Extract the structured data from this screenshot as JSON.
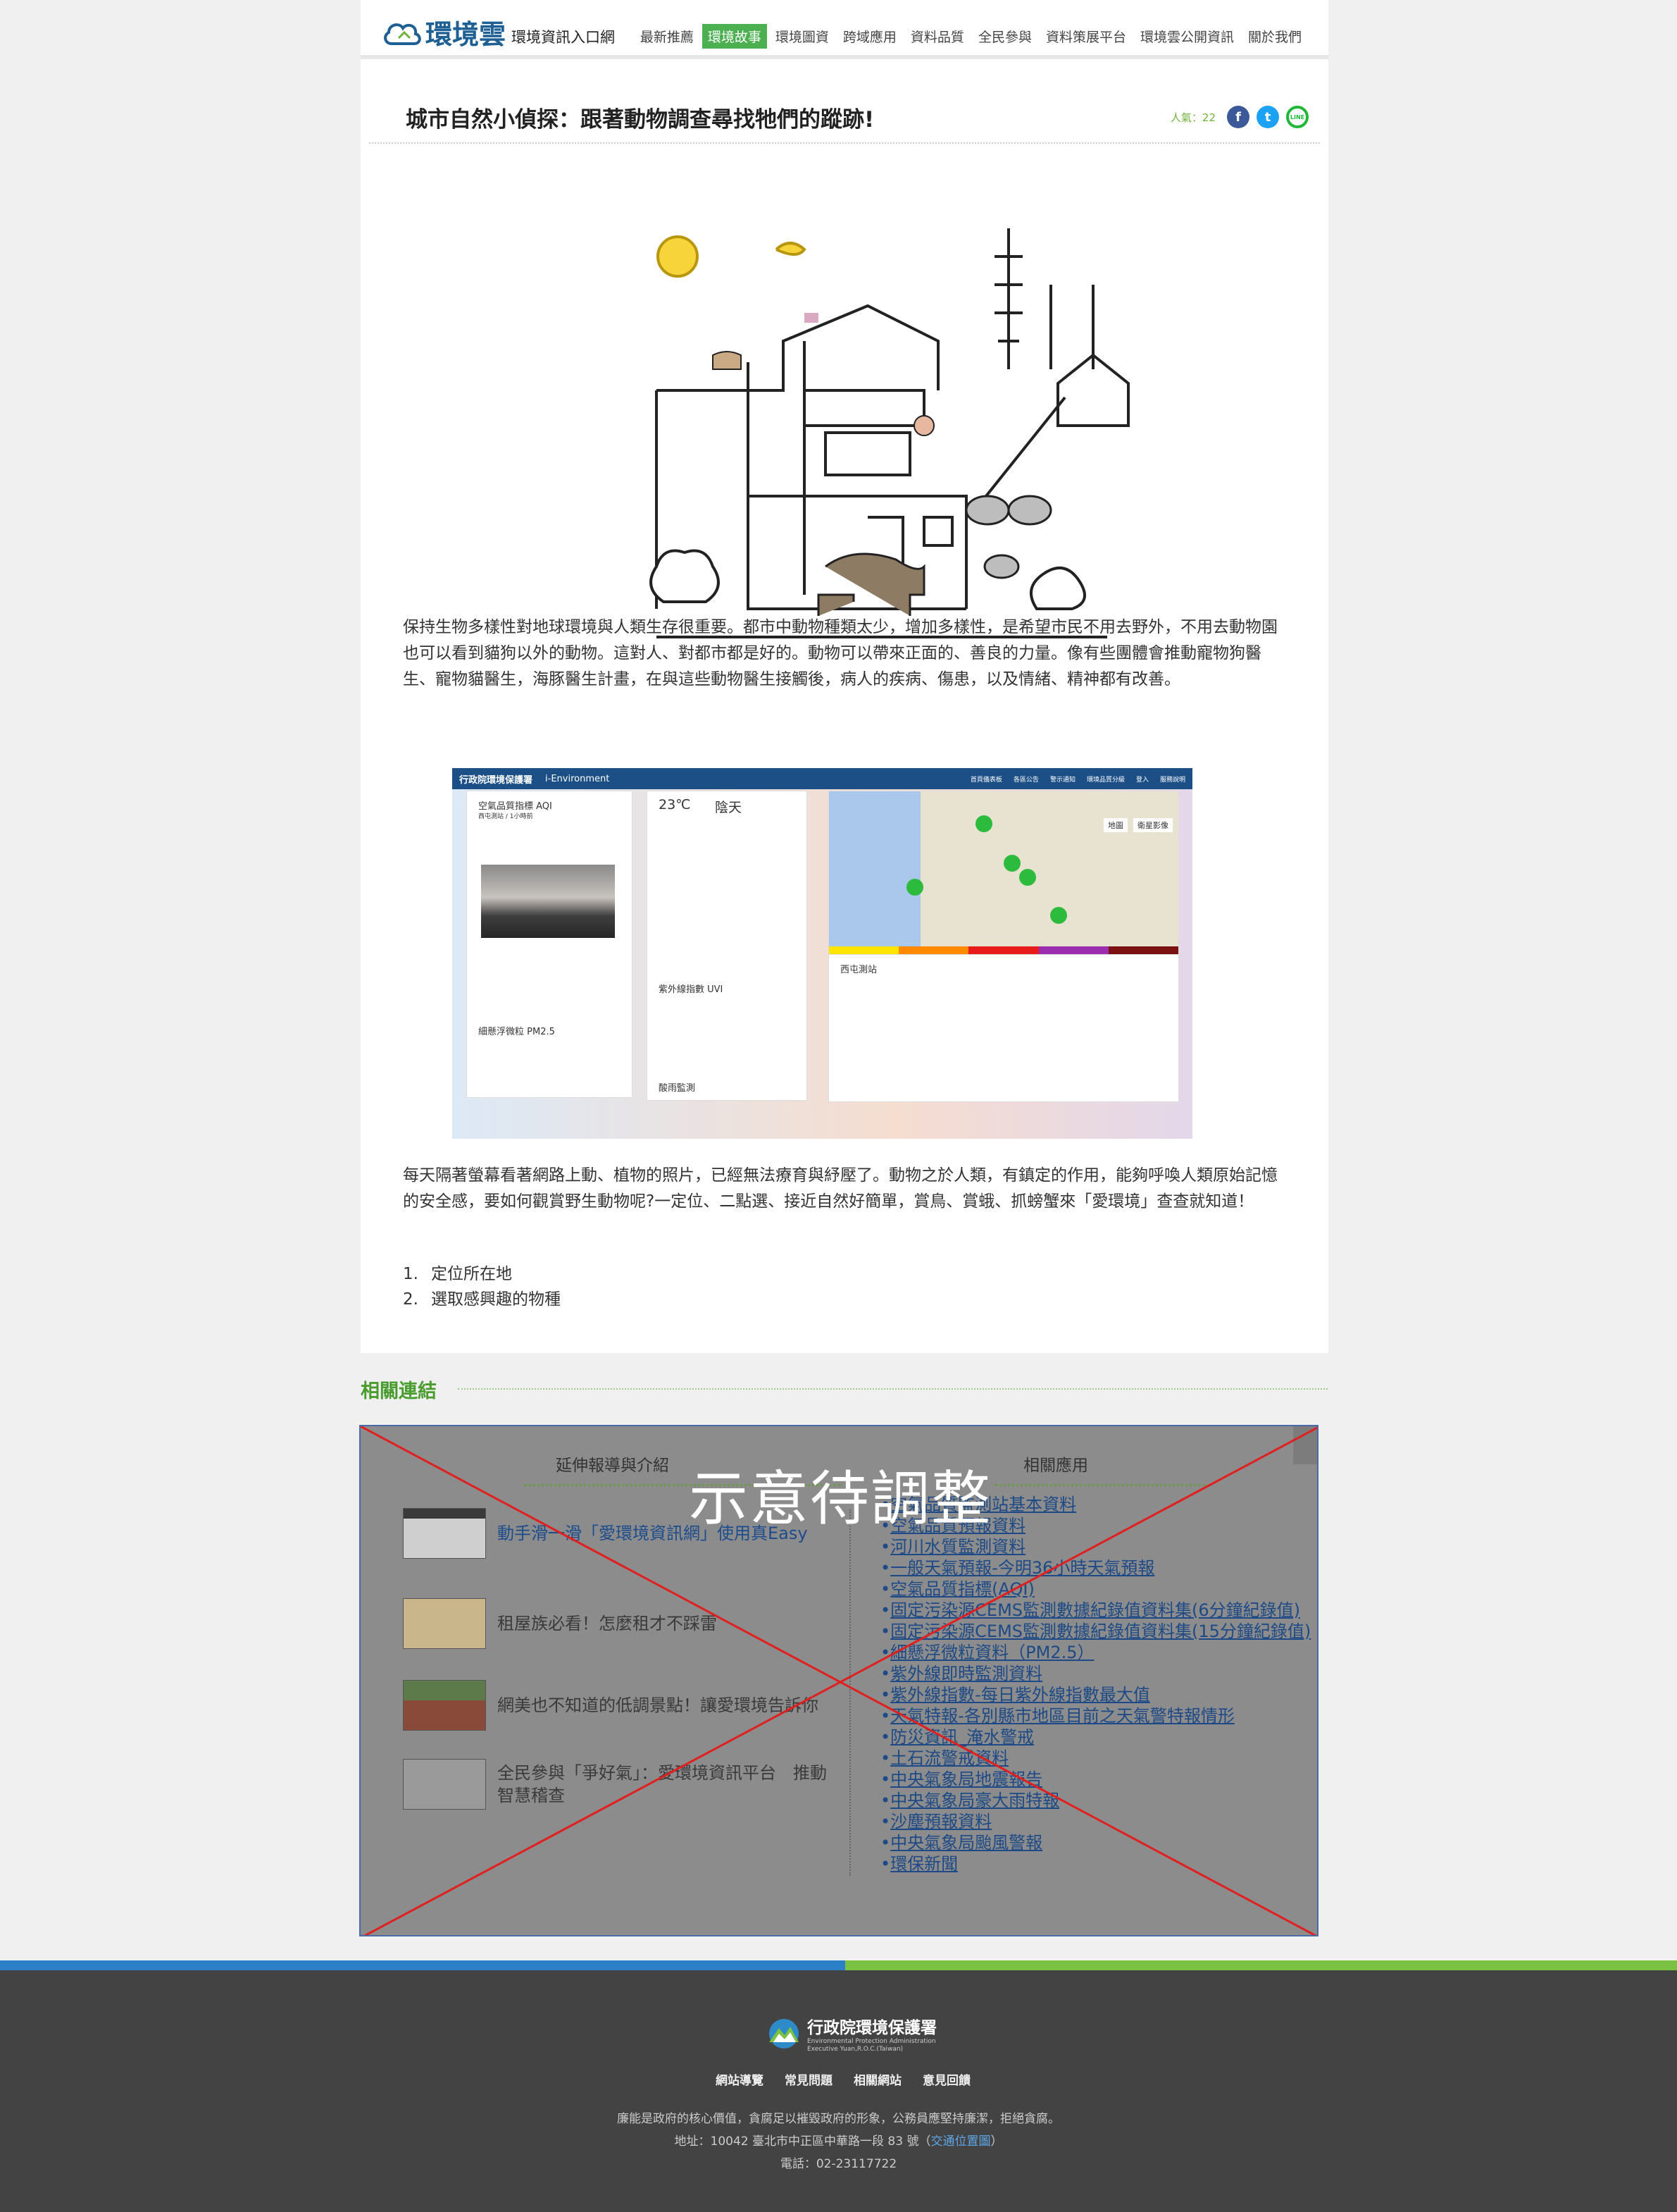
{
  "header": {
    "logo_title": "環境雲",
    "logo_subtitle": "環境資訊入口網",
    "nav": [
      "最新推薦",
      "環境故事",
      "環境圖資",
      "跨域應用",
      "資料品質",
      "全民參與",
      "資料策展平台",
      "環境雲公開資訊",
      "關於我們"
    ],
    "active_nav": "環境故事"
  },
  "article": {
    "title": "城市自然小偵探：跟著動物調查尋找牠們的蹤跡!",
    "views": "人氣：22",
    "share": {
      "facebook": "f",
      "twitter": "t",
      "line": "LINE"
    },
    "para1": "保持生物多樣性對地球環境與人類生存很重要。都市中動物種類太少，增加多樣性，是希望市民不用去野外，不用去動物園也可以看到貓狗以外的動物。這對人、對都市都是好的。動物可以帶來正面的、善良的力量。像有些團體會推動寵物狗醫生、寵物貓醫生，海豚醫生計畫，在與這些動物醫生接觸後，病人的疾病、傷患，以及情緒、精神都有改善。",
    "para2": "每天隔著螢幕看著網路上動、植物的照片，已經無法療育與紓壓了。動物之於人類，有鎮定的作用，能夠呼喚人類原始記憶的安全感，要如何觀賞野生動物呢?一定位、二點選、接近自然好簡單，賞鳥、賞蛾、抓螃蟹來「愛環境」查查就知道！",
    "steps": [
      {
        "num": "1.",
        "text": "定位所在地"
      },
      {
        "num": "2.",
        "text": "選取感興趣的物種"
      }
    ]
  },
  "embedded_screenshot": {
    "brand": "行政院環境保護署",
    "brand2": "i-Environment",
    "links": [
      "首頁儀表板",
      "各區公告",
      "警示通知",
      "環境品質分級",
      "登入",
      "服務說明"
    ],
    "aqi_title": "空氣品質指標 AQI",
    "aqi_station": "西屯測站 / 1小時前",
    "weather_temp": "23℃",
    "weather_desc": "陰天",
    "uvi_title": "紫外線指數 UVI",
    "pm_title": "細懸浮微粒 PM2.5",
    "noise_title": "酸雨監測",
    "station_title": "西屯測站",
    "map_labels": [
      "地圖",
      "衛星影像"
    ]
  },
  "related": {
    "section_title": "相關連結",
    "left_head": "延伸報導與介紹",
    "right_head": "相關應用",
    "overlay_text": "示意待調整",
    "news": [
      "動手滑一滑「愛環境資訊網」使用真Easy",
      "租屋族必看！怎麼租才不踩雷",
      "網美也不知道的低調景點！讓愛環境告訴你",
      "全民參與「爭好氣」：愛環境資訊平台　推動智慧稽查"
    ],
    "apps": [
      "空氣品質監測站基本資料",
      "空氣品質預報資料",
      "河川水質監測資料",
      "一般天氣預報-今明36小時天氣預報",
      "空氣品質指標(AQI)",
      "固定污染源CEMS監測數據紀錄值資料集(6分鐘紀錄值)",
      "固定污染源CEMS監測數據紀錄值資料集(15分鐘紀錄值)",
      "細懸浮微粒資料（PM2.5）",
      "紫外線即時監測資料",
      "紫外線指數-每日紫外線指數最大值",
      "天氣特報-各別縣市地區目前之天氣警特報情形",
      "防災資訊_淹水警戒",
      "土石流警戒資料",
      "中央氣象局地震報告",
      "中央氣象局豪大雨特報",
      "沙塵預報資料",
      "中央氣象局颱風警報",
      "環保新聞"
    ]
  },
  "footer": {
    "org_cn": "行政院環境保護署",
    "org_en1": "Environmental Protection Administration",
    "org_en2": "Executive Yuan,R.O.C.(Taiwan)",
    "links": [
      "網站導覽",
      "常見問題",
      "相關網站",
      "意見回饋"
    ],
    "slogan": "廉能是政府的核心價值，貪腐足以摧毀政府的形象，公務員應堅持廉潔，拒絕貪腐。",
    "address": "地址：10042 臺北市中正區中華路一段 83 號（",
    "address_link": "交通位置圖",
    "address_end": "）",
    "phone": "電話：02-23117722"
  }
}
